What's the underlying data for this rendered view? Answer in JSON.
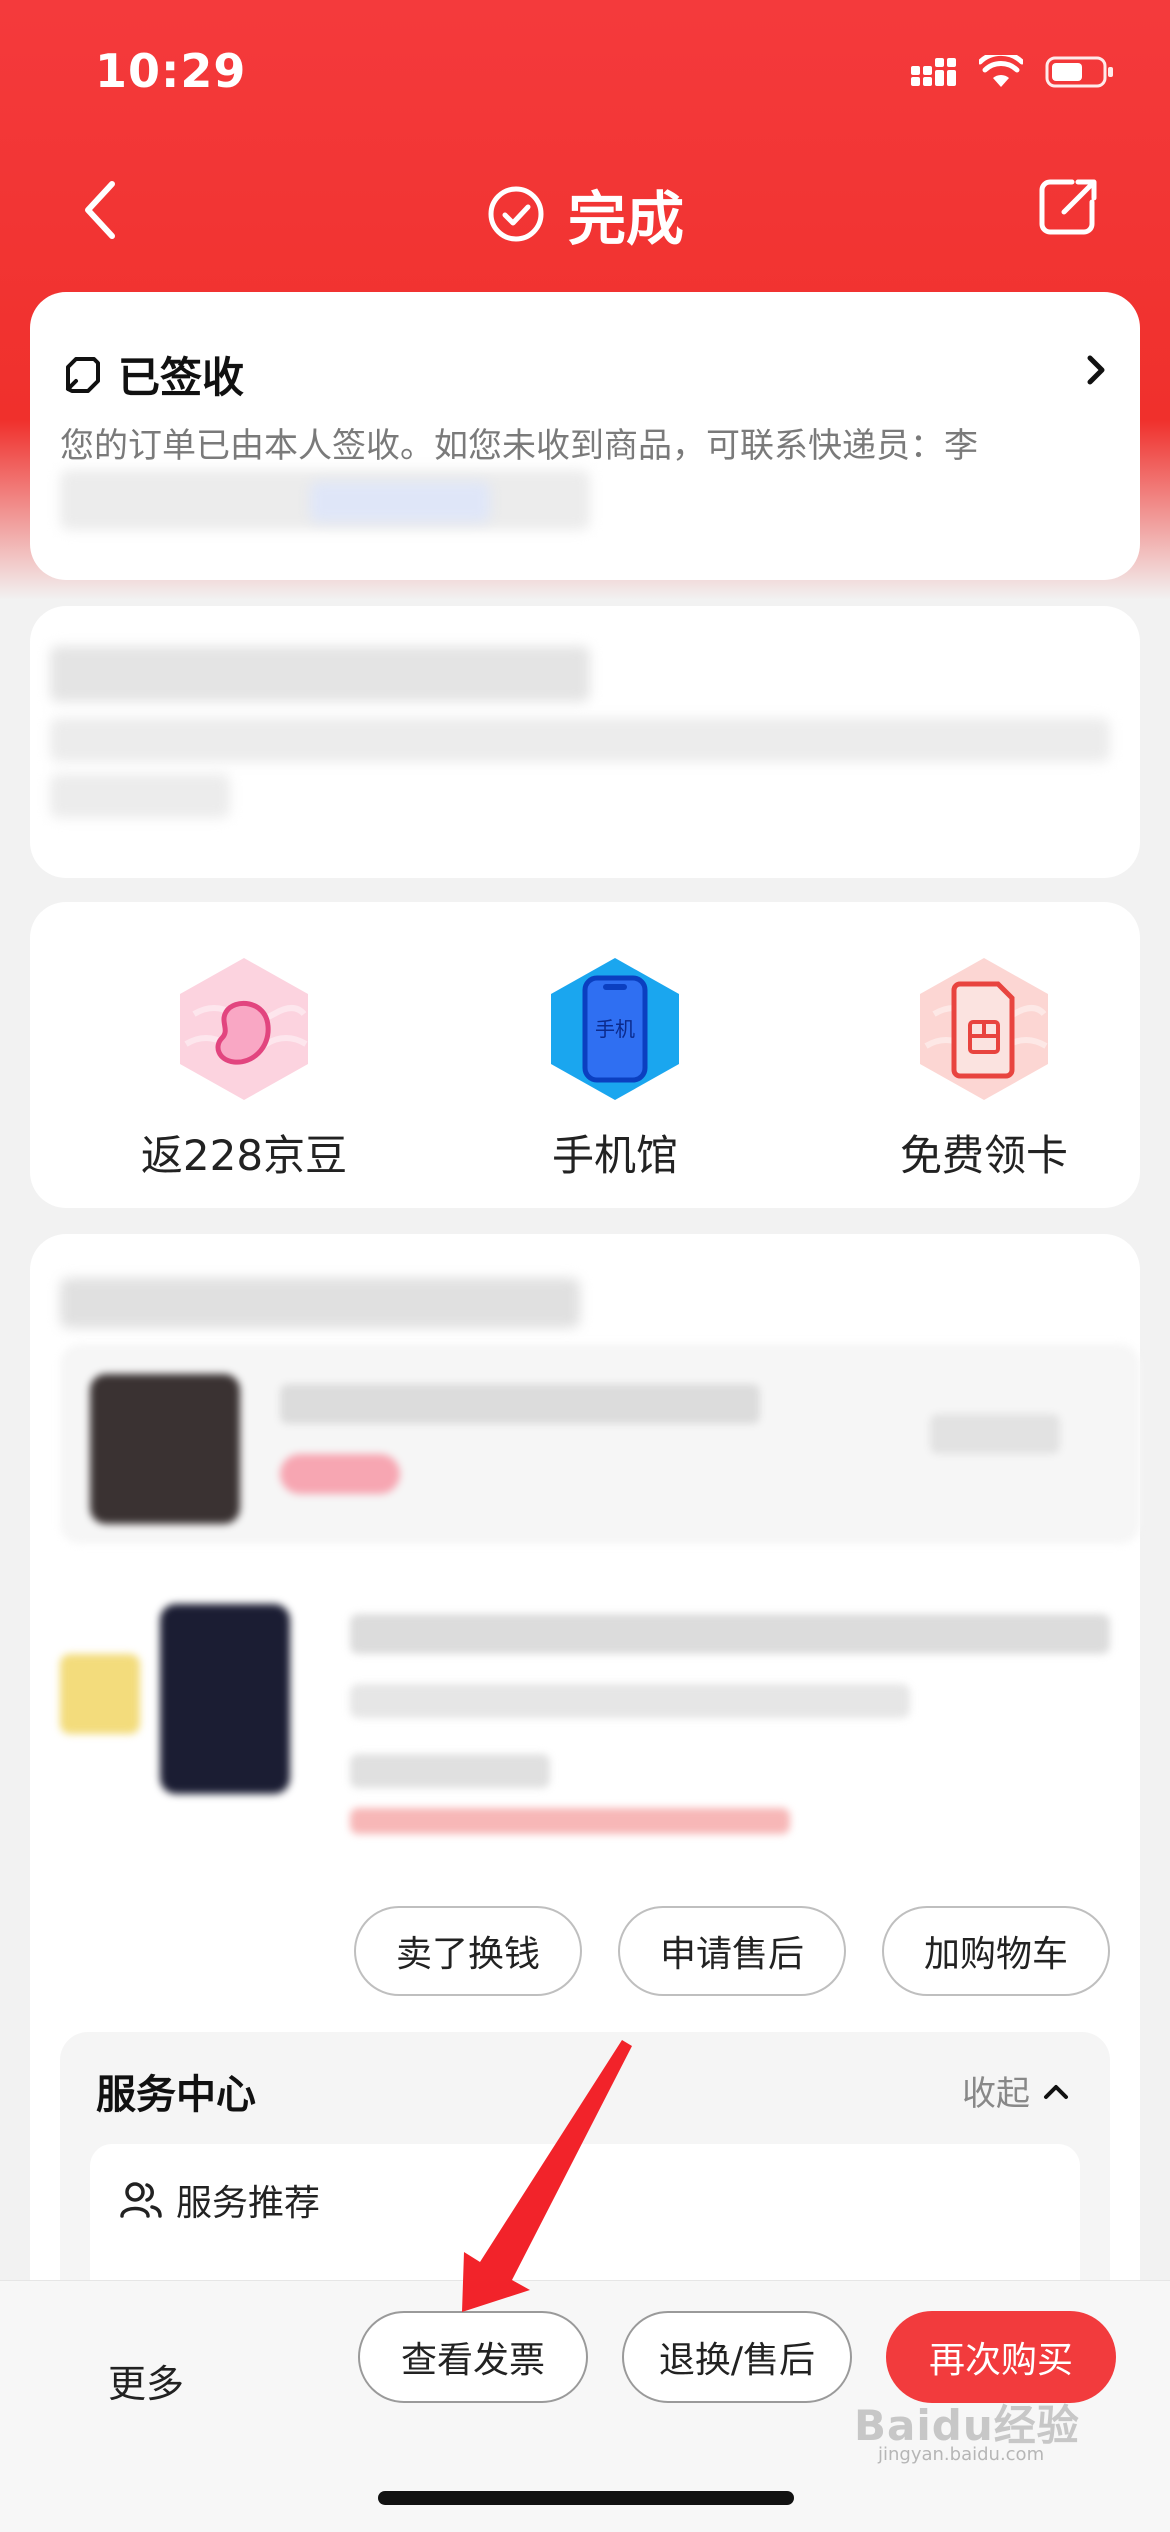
{
  "status_bar": {
    "time": "10:29"
  },
  "nav": {
    "title": "完成"
  },
  "signed_card": {
    "title": "已签收",
    "description": "您的订单已由本人签收。如您未收到商品，可联系快递员：李"
  },
  "quick_links": [
    {
      "label": "返228京豆",
      "icon": "bean-icon"
    },
    {
      "label": "手机馆",
      "icon": "phone-icon",
      "icon_text": "手机"
    },
    {
      "label": "免费领卡",
      "icon": "sim-card-icon"
    }
  ],
  "product_actions": [
    "卖了换钱",
    "申请售后",
    "加购物车"
  ],
  "service_center": {
    "title": "服务中心",
    "collapse_label": "收起",
    "recommend_label": "服务推荐"
  },
  "bottom_bar": {
    "more": "更多",
    "buttons": [
      "查看发票",
      "退换/售后",
      "再次购买"
    ]
  },
  "watermark": {
    "text": "Baidu经验",
    "sub": "jingyan.baidu.com"
  },
  "colors": {
    "brand_red": "#f0302c",
    "primary_button": "#f23b3d"
  }
}
